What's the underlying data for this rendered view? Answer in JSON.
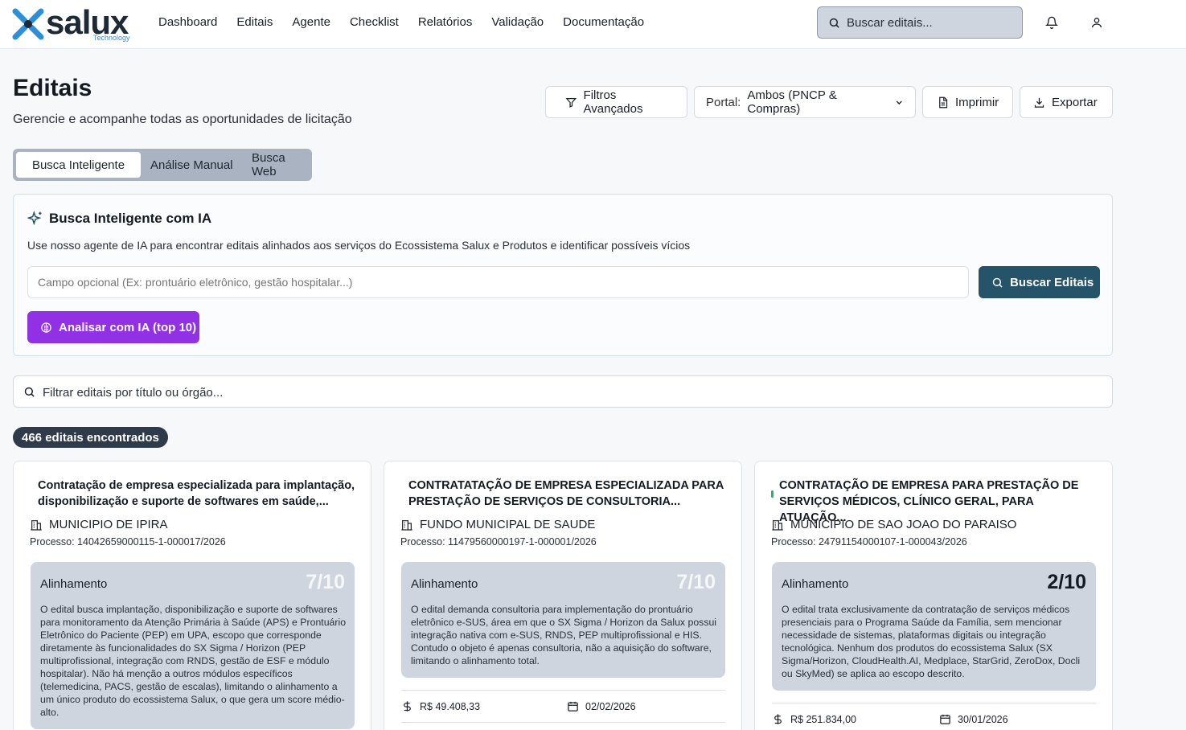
{
  "brand": {
    "name": "salux",
    "tagline": "Technology"
  },
  "nav": [
    "Dashboard",
    "Editais",
    "Agente",
    "Checklist",
    "Relatórios",
    "Validação",
    "Documentação"
  ],
  "header_search": {
    "placeholder": "Buscar editais..."
  },
  "page": {
    "title": "Editais",
    "subtitle": "Gerencie e acompanhe todas as oportunidades de licitação"
  },
  "toolbar": {
    "filters_label": "Filtros Avançados",
    "portal_label": "Portal:",
    "portal_value": "Ambos (PNCP & Compras)",
    "print_label": "Imprimir",
    "export_label": "Exportar"
  },
  "tabs": [
    "Busca Inteligente",
    "Análise Manual",
    "Busca Web"
  ],
  "ai_search": {
    "title": "Busca Inteligente com IA",
    "description": "Use nosso agente de IA para encontrar editais alinhados aos serviços do Ecossistema Salux e Produtos e identificar possíveis vícios",
    "input_placeholder": "Campo opcional (Ex: prontuário eletrônico, gestão hospitalar...)",
    "search_button": "Buscar Editais",
    "analyze_button": "Analisar com IA (top 10)"
  },
  "filter": {
    "placeholder": "Filtrar editais por título ou órgão..."
  },
  "results_count": "466 editais encontrados",
  "alignment_label": "Alinhamento",
  "cards": [
    {
      "title": "Contratação de empresa especializada para implantação, disponibilização e suporte de softwares em saúde,...",
      "org": "MUNICIPIO DE IPIRA",
      "process": "Processo: 14042659000115-1-000017/2026",
      "score": "7/10",
      "analysis": "O edital busca implantação, disponibilização e suporte de softwares para monitoramento da Atenção Primária à Saúde (APS) e Prontuário Eletrônico do Paciente (PEP) em UPA, escopo que corresponde diretamente às funcionalidades do SX Sigma / Horizon (PEP multiprofissional, integração com RNDS, gestão de ESF e módulo hospitalar). Não há menção a outros módulos específicos (telemedicina, PACS, gestão de escalas), limitando o alinhamento a um único produto do ecossistema Salux, o que gera um score médio-alto.",
      "value": "",
      "date": ""
    },
    {
      "title": "CONTRATATAÇÃO DE EMPRESA ESPECIALIZADA PARA PRESTAÇÃO DE SERVIÇOS DE CONSULTORIA...",
      "org": "FUNDO MUNICIPAL DE SAUDE",
      "process": "Processo: 11479560000197-1-000001/2026",
      "score": "7/10",
      "analysis": "O edital demanda consultoria para implementação do prontuário eletrônico e-SUS, área em que o SX Sigma / Horizon da Salux possui integração nativa com e-SUS, RNDS, PEP multiprofissional e HIS. Contudo o objeto é apenas consultoria, não a aquisição do software, limitando o alinhamento total.",
      "value": "R$ 49.408,33",
      "date": "02/02/2026"
    },
    {
      "title": "CONTRATAÇÃO DE EMPRESA PARA PRESTAÇÃO DE SERVIÇOS MÉDICOS, CLÍNICO GERAL, PARA ATUAÇÃO...",
      "org": "MUNICIPIO DE SAO JOAO DO PARAISO",
      "process": "Processo: 24791154000107-1-000043/2026",
      "score": "2/10",
      "analysis": "O edital trata exclusivamente da contratação de serviços médicos presenciais para o Programa Saúde da Família, sem mencionar necessidade de sistemas, plataformas digitais ou integração tecnológica. Nenhum dos produtos do ecossistema Salux (SX Sigma/Horizon, CloudHealth.AI, Medplace, StarGrid, ZeroDox, Docli ou SkyMed) se aplica ao escopo descrito.",
      "value": "R$ 251.834,00",
      "date": "30/01/2026"
    }
  ],
  "colors": {
    "primary": "#25536a",
    "ai_purple": "#9230e6",
    "badge": "#2f3b4b",
    "accent_green": "#25b36a",
    "logo_blue": "#2c8fd8"
  }
}
